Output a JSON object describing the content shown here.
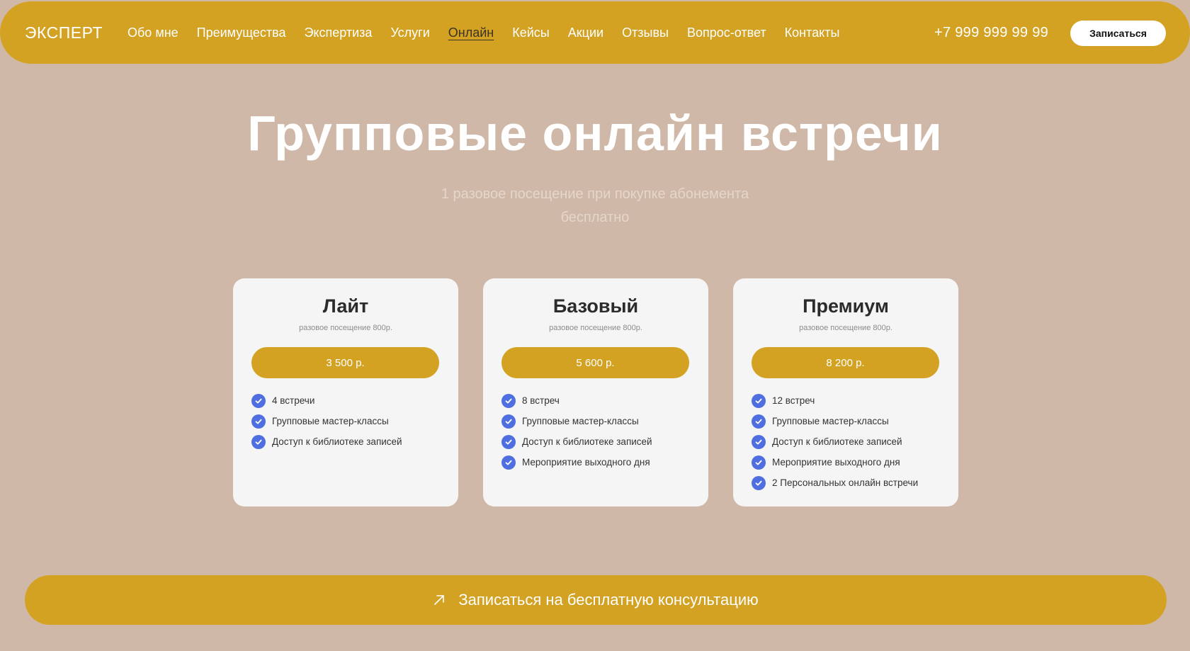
{
  "header": {
    "logo": "ЭКСПЕРТ",
    "nav": [
      {
        "label": "Обо мне",
        "active": false
      },
      {
        "label": "Преимущества",
        "active": false
      },
      {
        "label": "Экспертиза",
        "active": false
      },
      {
        "label": "Услуги",
        "active": false
      },
      {
        "label": "Онлайн",
        "active": true
      },
      {
        "label": "Кейсы",
        "active": false
      },
      {
        "label": "Акции",
        "active": false
      },
      {
        "label": "Отзывы",
        "active": false
      },
      {
        "label": "Вопрос-ответ",
        "active": false
      },
      {
        "label": "Контакты",
        "active": false
      }
    ],
    "phone": "+7 999 999 99 99",
    "signup_label": "Записаться"
  },
  "hero": {
    "title": "Групповые онлайн встречи",
    "subtitle": "1 разовое посещение при покупке абонемента бесплатно"
  },
  "plans": [
    {
      "name": "Лайт",
      "note": "разовое посещение 800р.",
      "price": "3 500 р.",
      "features": [
        "4 встречи",
        "Групповые мастер-классы",
        "Доступ к библиотеке записей"
      ]
    },
    {
      "name": "Базовый",
      "note": "разовое посещение 800р.",
      "price": "5 600 р.",
      "features": [
        "8 встреч",
        "Групповые мастер-классы",
        "Доступ к библиотеке записей",
        "Мероприятие выходного дня"
      ]
    },
    {
      "name": "Премиум",
      "note": "разовое посещение 800р.",
      "price": "8 200 р.",
      "features": [
        "12 встреч",
        "Групповые мастер-классы",
        "Доступ к библиотеке записей",
        "Мероприятие выходного дня",
        "2 Персональных онлайн встречи"
      ]
    }
  ],
  "cta": {
    "label": "Записаться на бесплатную консультацию",
    "icon": "arrow-up-right-icon"
  },
  "colors": {
    "background": "#cfb8a8",
    "accent": "#d3a223",
    "card": "#f5f5f5",
    "check": "#4f6fe0"
  }
}
